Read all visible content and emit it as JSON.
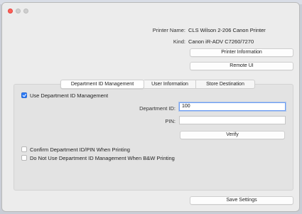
{
  "printer": {
    "name_label": "Printer Name:",
    "name_value": "CLS Wilson 2-206 Canon Printer",
    "kind_label": "Kind:",
    "kind_value": "Canon iR-ADV C7260/7270"
  },
  "buttons": {
    "printer_information": "Printer Information",
    "remote_ui": "Remote UI",
    "verify": "Verify",
    "save_settings": "Save Settings"
  },
  "tabs": [
    {
      "label": "Department ID Management",
      "active": true
    },
    {
      "label": "User Information",
      "active": false
    },
    {
      "label": "Store Destination",
      "active": false
    }
  ],
  "department": {
    "use_label": "Use Department ID Management",
    "use_checked": true,
    "id_label": "Department ID:",
    "id_value": "100",
    "pin_label": "PIN:",
    "pin_value": "",
    "confirm_label": "Confirm Department ID/PIN When Printing",
    "confirm_checked": false,
    "bw_label": "Do Not Use Department ID Management When B&W Printing",
    "bw_checked": false
  },
  "colors": {
    "accent": "#2f7cf6",
    "close_button": "#ff5f57"
  }
}
